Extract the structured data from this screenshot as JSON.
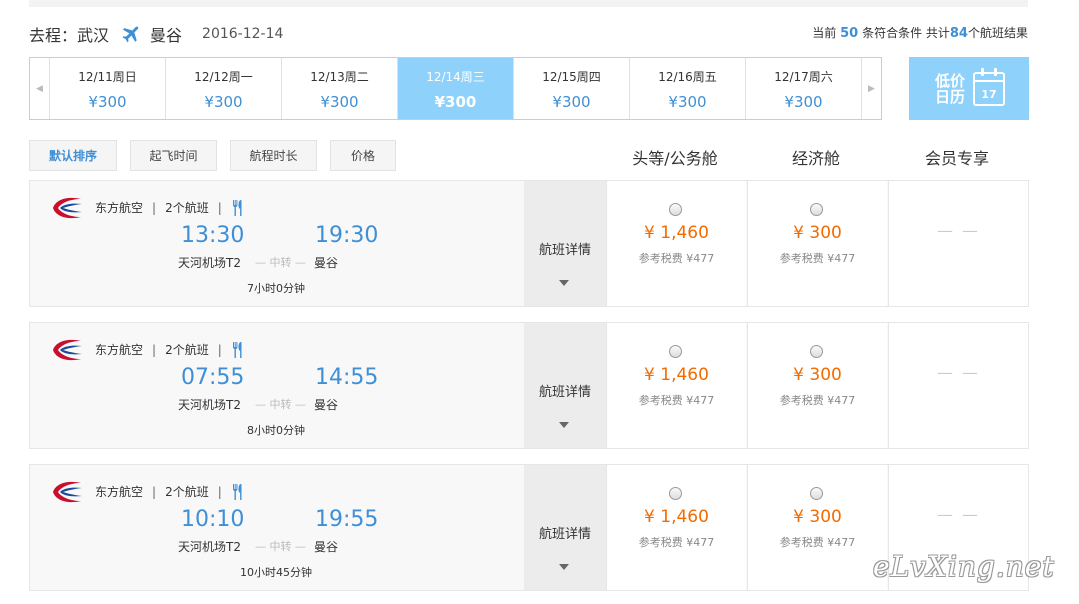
{
  "route": {
    "label": "去程：武汉",
    "destination": "曼谷",
    "date": "2016-12-14"
  },
  "summary": {
    "prefix": "当前",
    "matching": "50",
    "mid": "条符合条件 共计",
    "total": "84",
    "suffix": "个航班结果"
  },
  "dates": [
    {
      "day": "12/11周日",
      "price": "¥300",
      "active": false
    },
    {
      "day": "12/12周一",
      "price": "¥300",
      "active": false
    },
    {
      "day": "12/13周二",
      "price": "¥300",
      "active": false
    },
    {
      "day": "12/14周三",
      "price": "¥300",
      "active": true
    },
    {
      "day": "12/15周四",
      "price": "¥300",
      "active": false
    },
    {
      "day": "12/16周五",
      "price": "¥300",
      "active": false
    },
    {
      "day": "12/17周六",
      "price": "¥300",
      "active": false
    }
  ],
  "low_price_calendar": {
    "line1": "低价",
    "line2": "日历",
    "day": "17"
  },
  "sort": [
    {
      "label": "默认排序",
      "active": true
    },
    {
      "label": "起飞时间",
      "active": false
    },
    {
      "label": "航程时长",
      "active": false
    },
    {
      "label": "价格",
      "active": false
    }
  ],
  "columns": {
    "first": "头等/公务舱",
    "economy": "经济舱",
    "member": "会员专享"
  },
  "flights": [
    {
      "airline": "东方航空",
      "count": "2个航班",
      "dep_time": "13:30",
      "arr_time": "19:30",
      "dep_airport": "天河机场T2",
      "arr_airport": "曼谷",
      "transfer": "— 中转 —",
      "duration": "7小时0分钟",
      "details": "航班详情",
      "first_price": "¥ 1,460",
      "first_tax": "参考税费 ¥477",
      "econ_price": "¥ 300",
      "econ_tax": "参考税费 ¥477",
      "member": "— —"
    },
    {
      "airline": "东方航空",
      "count": "2个航班",
      "dep_time": "07:55",
      "arr_time": "14:55",
      "dep_airport": "天河机场T2",
      "arr_airport": "曼谷",
      "transfer": "— 中转 —",
      "duration": "8小时0分钟",
      "details": "航班详情",
      "first_price": "¥ 1,460",
      "first_tax": "参考税费 ¥477",
      "econ_price": "¥ 300",
      "econ_tax": "参考税费 ¥477",
      "member": "— —"
    },
    {
      "airline": "东方航空",
      "count": "2个航班",
      "dep_time": "10:10",
      "arr_time": "19:55",
      "dep_airport": "天河机场T2",
      "arr_airport": "曼谷",
      "transfer": "— 中转 —",
      "duration": "10小时45分钟",
      "details": "航班详情",
      "first_price": "¥ 1,460",
      "first_tax": "参考税费 ¥477",
      "econ_price": "¥ 300",
      "econ_tax": "参考税费 ¥477",
      "member": "— —"
    }
  ],
  "watermark": "eLvXing.net",
  "colors": {
    "accent": "#3f8fd6",
    "highlight": "#8ed1fb",
    "price": "#f26b00"
  },
  "icons": {
    "plane": "plane-icon",
    "meal": "fork-knife-icon",
    "calendar": "calendar-icon",
    "logo": "china-eastern-logo"
  }
}
